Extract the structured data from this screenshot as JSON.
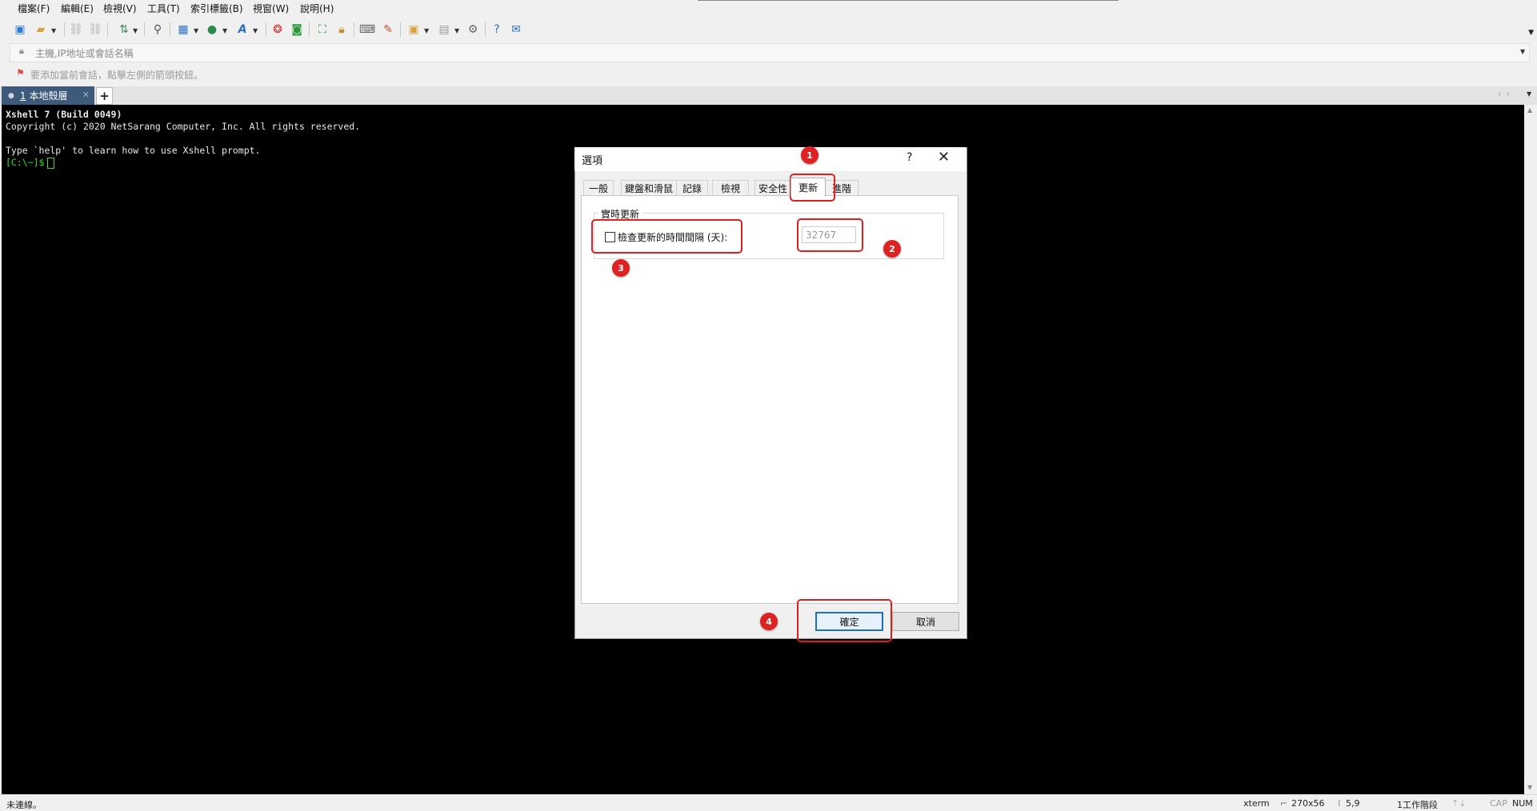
{
  "menu": [
    "檔案(F)",
    "編輯(E)",
    "檢視(V)",
    "工具(T)",
    "索引標籤(B)",
    "視窗(W)",
    "說明(H)"
  ],
  "toolbar": {
    "icons": [
      "new-session-icon",
      "open-folder-icon",
      "reconnect-icon",
      "disconnect-icon",
      "transfer-icon",
      "find-icon",
      "properties-icon",
      "globe-icon",
      "font-icon",
      "xftp-icon",
      "screenshot-icon",
      "fullscreen-icon",
      "lock-icon",
      "keyboard-icon",
      "highlight-icon",
      "script-icon",
      "layout-icon",
      "settings-icon",
      "help-icon",
      "chat-icon"
    ]
  },
  "address": {
    "placeholder": "主機,IP地址或會話名稱"
  },
  "hint": {
    "text": "要添加當前會話，點擊左側的箭頭按鈕。"
  },
  "tabs": [
    {
      "number": "1",
      "label": "本地殼層",
      "active": true
    }
  ],
  "terminal": {
    "lines": [
      "Xshell 7 (Build 0049)",
      "Copyright (c) 2020 NetSarang Computer, Inc. All rights reserved.",
      "",
      "Type `help' to learn how to use Xshell prompt."
    ],
    "prompt": "[C:\\~]$"
  },
  "dialog": {
    "title": "選項",
    "help": "?",
    "close": "✕",
    "tabs": [
      "一般",
      "鍵盤和滑鼠",
      "記錄",
      "檢視",
      "安全性",
      "更新",
      "進階"
    ],
    "active_tab": "更新",
    "group_title": "實時更新",
    "checkbox_label": "檢查更新的時間間隔 (天):",
    "checkbox_checked": false,
    "interval_value": "32767",
    "ok_label": "確定",
    "cancel_label": "取消"
  },
  "annotations": [
    "1",
    "2",
    "3",
    "4"
  ],
  "status": {
    "left": "未連線。",
    "term_type": "xterm",
    "size": "270x56",
    "cursor_pos": "5,9",
    "sessions": "1工作階段",
    "cap": "CAP",
    "num": "NUM"
  },
  "colors": {
    "accent": "#3d5a7a",
    "annotation": "#dd2222",
    "prompt": "#2fe02f"
  }
}
